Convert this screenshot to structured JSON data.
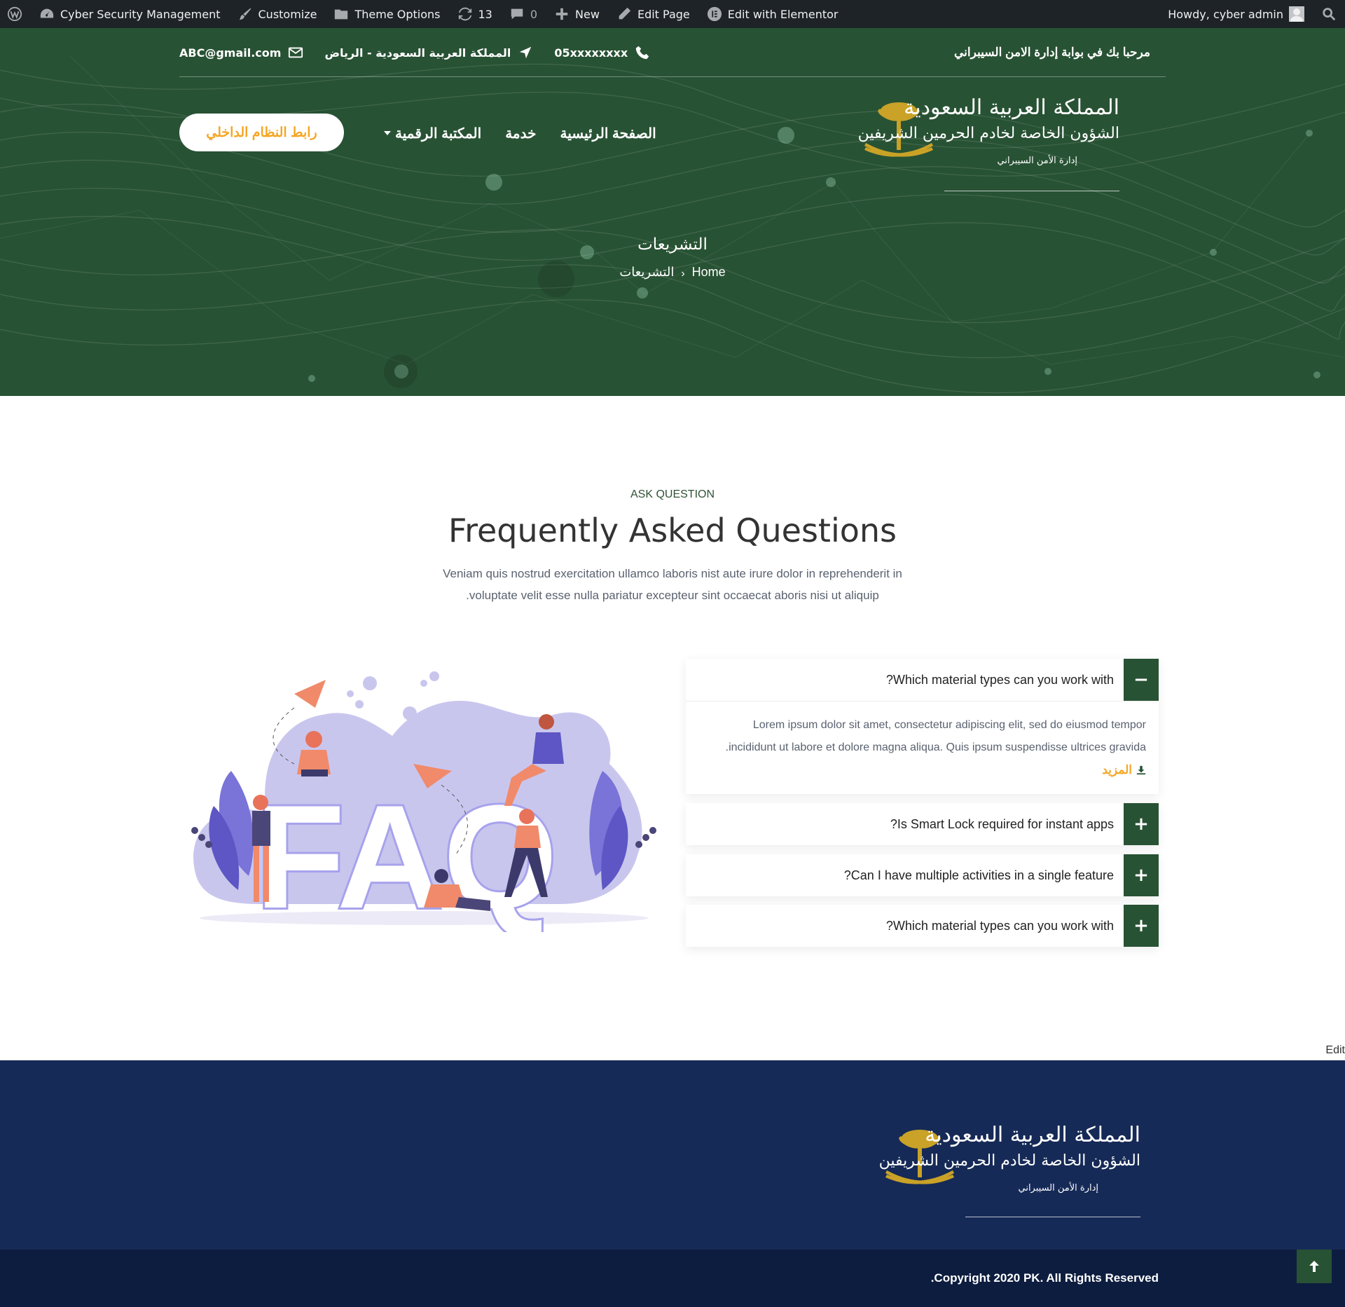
{
  "adminbar": {
    "site_name": "Cyber Security Management",
    "customize": "Customize",
    "theme_options": "Theme Options",
    "updates_count": "13",
    "comments_count": "0",
    "new": "New",
    "edit_page": "Edit Page",
    "edit_elementor": "Edit with Elementor",
    "howdy": "Howdy, cyber admin"
  },
  "topbar": {
    "email": "ABC@gmail.com",
    "location": "المملكة العربية السعودية - الرياض",
    "phone": "05xxxxxxxx",
    "welcome": "مرحبا بك في بوابة إدارة الامن السيبراني"
  },
  "logo": {
    "line1": "المملكة العربية السعودية",
    "line2": "الشؤون الخاصة لخادم الحرمين الشريفين",
    "line3": "إدارة الأمن السيبراني"
  },
  "nav": {
    "home": "الصفحة الرئيسية",
    "service": "خدمة",
    "library": "المكتبة الرقمية",
    "cta": "رابط النظام الداخلي"
  },
  "hero": {
    "title": "التشريعات",
    "breadcrumb_home": "Home",
    "breadcrumb_current": "التشريعات"
  },
  "faq": {
    "eyebrow": "ASK QUESTION",
    "heading": "Frequently Asked Questions",
    "intro_line1": "Veniam quis nostrud exercitation ullamco laboris nist aute irure dolor in reprehenderit in",
    "intro_line2": ".voluptate velit esse nulla pariatur excepteur sint occaecat aboris nisi ut aliquip",
    "art_text": "FAQ",
    "items": [
      {
        "question": "?Which material types can you work with",
        "toggle": "−",
        "answer_line1": "Lorem ipsum dolor sit amet, consectetur adipiscing elit, sed do eiusmod tempor",
        "answer_line2": ".incididunt ut labore et dolore magna aliqua. Quis ipsum suspendisse ultrices gravida",
        "more": "المزيد"
      },
      {
        "question": "?Is Smart Lock required for instant apps",
        "toggle": "+"
      },
      {
        "question": "?Can I have multiple activities in a single feature",
        "toggle": "+"
      },
      {
        "question": "?Which material types can you work with",
        "toggle": "+"
      }
    ]
  },
  "edit_link": "Edit",
  "footer": {
    "copyright": ".Copyright 2020 PK. All Rights Reserved"
  },
  "colors": {
    "adminbar": "#1d2327",
    "hero_green": "#285234",
    "accent_orange": "#f5a623",
    "gold": "#c9a227",
    "footer_navy": "#162a57",
    "copy_navy": "#0d1d3f"
  }
}
